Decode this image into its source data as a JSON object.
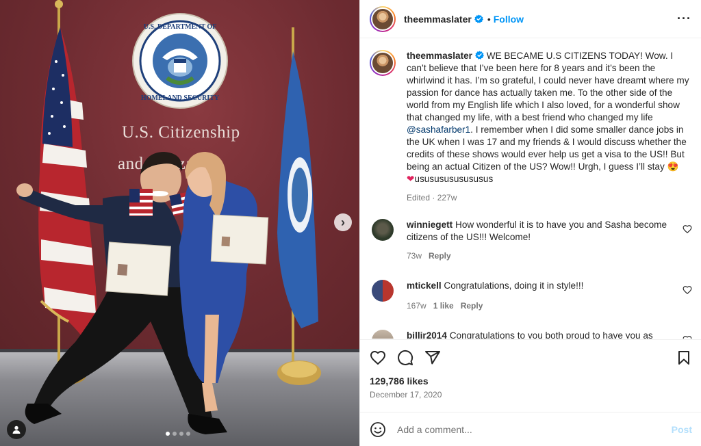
{
  "colors": {
    "accent": "#0095f6",
    "mention": "#00376b",
    "muted": "#737373",
    "post_disabled": "#b2dffc"
  },
  "photo": {
    "wall_text_line1": "U.S. Citizenship",
    "wall_text_line2": "and I... ization",
    "seal_text": "U.S. DEPARTMENT OF HOMELAND SECURITY",
    "carousel_next_icon": "chevron-right-icon",
    "slide_count": 4,
    "active_slide": 1
  },
  "header": {
    "username": "theemmaslater",
    "follow_separator": "•",
    "follow_label": "Follow",
    "more_icon": "more-horizontal-icon"
  },
  "caption": {
    "username": "theemmaslater",
    "text_before_mention": "WE BECAME U.S CITIZENS TODAY! Wow. I can’t believe that I’ve been here for 8 years and it’s been the whirlwind it has. I’m so grateful, I could never have dreamt where my passion for dance has actually taken me. To the other side of the world from my English life which I also loved, for a wonderful show that changed my life, with a best friend who changed my life",
    "mention": "@sashafarber1",
    "text_after_mention": ". I remember when I did some smaller dance jobs in the UK when I was 17 and my friends & I would discuss whether the credits of these shows would ever help us get a visa to the US!! But being an actual Citizen of the US? Wow!! Urgh, I guess I’ll stay 😍",
    "heart": "❤",
    "trailing": "usususususususus",
    "meta": "Edited · 227w"
  },
  "comments": [
    {
      "username": "winniegett",
      "text": "How wonderful it is to have you and Sasha become citizens of the US!!! Welcome!",
      "time": "73w",
      "likes": "",
      "reply": "Reply"
    },
    {
      "username": "mtickell",
      "text": "Congratulations, doing it in style!!!",
      "time": "167w",
      "likes": "1 like",
      "reply": "Reply"
    },
    {
      "username": "billjr2014",
      "text": "Congratulations to you both proud to have you as",
      "time": "",
      "likes": "",
      "reply": ""
    }
  ],
  "actions": {
    "likes": "129,786 likes",
    "date": "December 17, 2020"
  },
  "add_comment": {
    "placeholder": "Add a comment...",
    "post_label": "Post"
  }
}
